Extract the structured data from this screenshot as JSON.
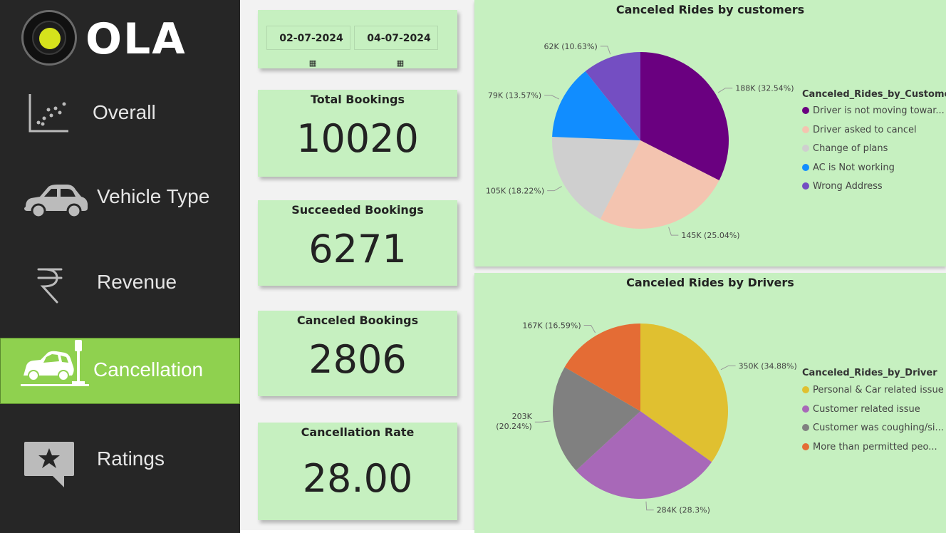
{
  "brand": {
    "name": "OLA"
  },
  "nav": {
    "items": [
      {
        "label": "Overall",
        "icon": "scatter-chart-icon",
        "active": false
      },
      {
        "label": "Vehicle Type",
        "icon": "car-icon",
        "active": false
      },
      {
        "label": "Revenue",
        "icon": "rupee-icon",
        "active": false
      },
      {
        "label": "Cancellation",
        "icon": "car-crash-icon",
        "active": true
      },
      {
        "label": "Ratings",
        "icon": "star-chat-icon",
        "active": false
      }
    ]
  },
  "date_range": {
    "start": "02-07-2024",
    "end": "04-07-2024",
    "icon": "calendar-icon"
  },
  "kpis": [
    {
      "title": "Total Bookings",
      "value": "10020"
    },
    {
      "title": "Succeeded Bookings",
      "value": "6271"
    },
    {
      "title": "Canceled Bookings",
      "value": "2806"
    },
    {
      "title": "Cancellation Rate",
      "value": "28.00"
    }
  ],
  "colors": {
    "sidebar_bg": "#262626",
    "active_nav": "#8fd14f",
    "card_bg": "#c6f0c0"
  },
  "chart_data": [
    {
      "type": "pie",
      "title": "Canceled Rides by customers",
      "legend_title": "Canceled_Rides_by_Customer",
      "legend_placement": "right",
      "slices": [
        {
          "name": "Driver is not moving towar...",
          "value": 188,
          "percent": 32.54,
          "label": "188K (32.54%)",
          "color": "#6a0080"
        },
        {
          "name": "Driver asked to cancel",
          "value": 145,
          "percent": 25.04,
          "label": "145K (25.04%)",
          "color": "#f4c4b0"
        },
        {
          "name": "Change of plans",
          "value": 105,
          "percent": 18.22,
          "label": "105K (18.22%)",
          "color": "#cfcfcf"
        },
        {
          "name": "AC is Not working",
          "value": 79,
          "percent": 13.57,
          "label": "79K (13.57%)",
          "color": "#118dff"
        },
        {
          "name": "Wrong Address",
          "value": 62,
          "percent": 10.63,
          "label": "62K (10.63%)",
          "color": "#744ec2"
        }
      ]
    },
    {
      "type": "pie",
      "title": "Canceled Rides by Drivers",
      "legend_title": "Canceled_Rides_by_Driver",
      "legend_placement": "right",
      "slices": [
        {
          "name": "Personal & Car related issue",
          "value": 350,
          "percent": 34.88,
          "label": "350K (34.88%)",
          "color": "#e0c030"
        },
        {
          "name": "Customer related issue",
          "value": 284,
          "percent": 28.3,
          "label": "284K (28.3%)",
          "color": "#a868b8"
        },
        {
          "name": "Customer was coughing/si...",
          "value": 203,
          "percent": 20.24,
          "label": "203K (20.24%)",
          "color": "#808080"
        },
        {
          "name": "More than permitted peo...",
          "value": 167,
          "percent": 16.59,
          "label": "167K (16.59%)",
          "color": "#e46c35"
        }
      ]
    }
  ]
}
